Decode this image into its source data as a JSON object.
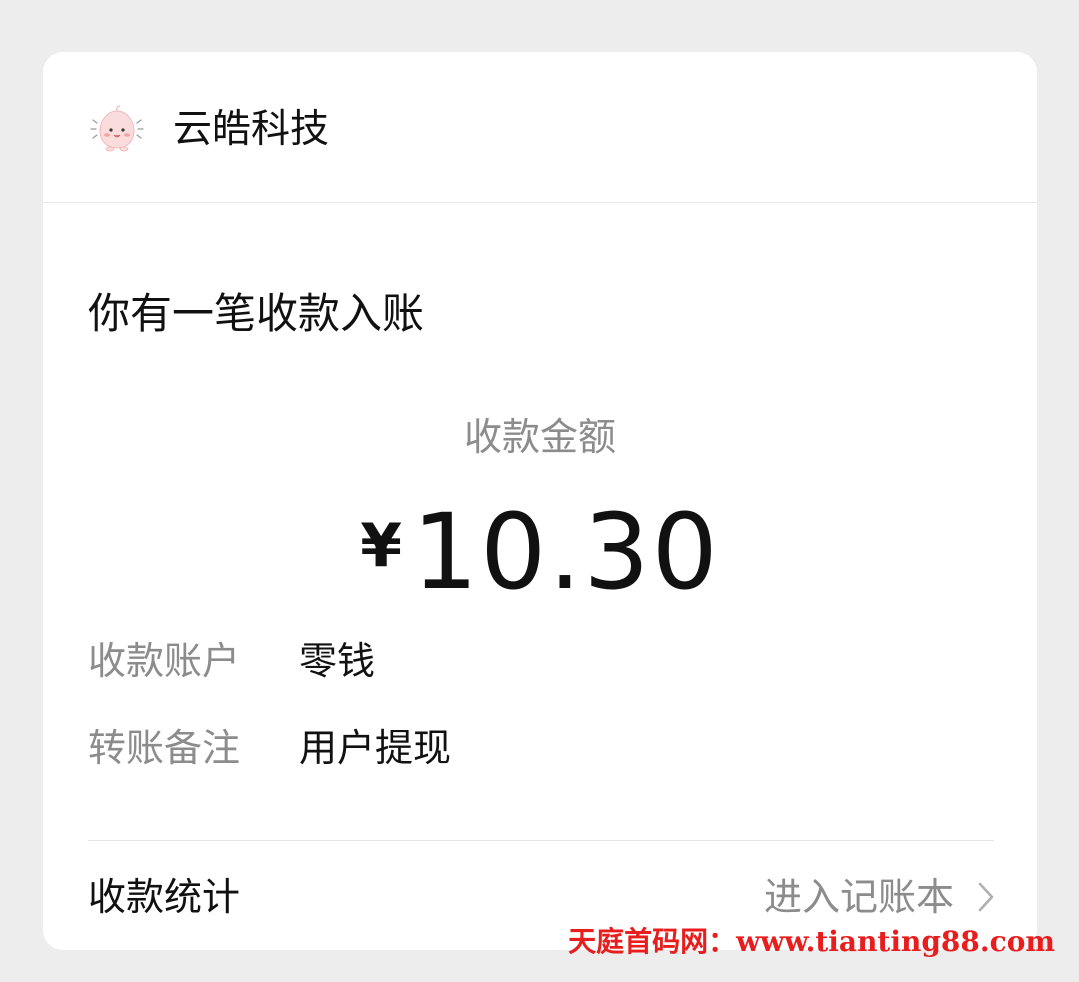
{
  "header": {
    "merchant_name": "云皓科技",
    "avatar_icon": "peach-mascot-icon"
  },
  "notice": {
    "title": "你有一笔收款入账"
  },
  "amount": {
    "label": "收款金额",
    "currency_symbol": "¥",
    "value": "10.30"
  },
  "details": [
    {
      "label": "收款账户",
      "value": "零钱"
    },
    {
      "label": "转账备注",
      "value": "用户提现"
    }
  ],
  "footer": {
    "stats_label": "收款统计",
    "ledger_link": "进入记账本",
    "link_icon": "chevron-right-icon"
  },
  "watermark": {
    "text": "天庭首码网：www.tianting88.com",
    "color": "#e81e1e"
  },
  "colors": {
    "background": "#ededed",
    "card": "#ffffff",
    "primary_text": "#111111",
    "secondary_text": "#8c8c8c",
    "divider": "#e6e6e6"
  }
}
